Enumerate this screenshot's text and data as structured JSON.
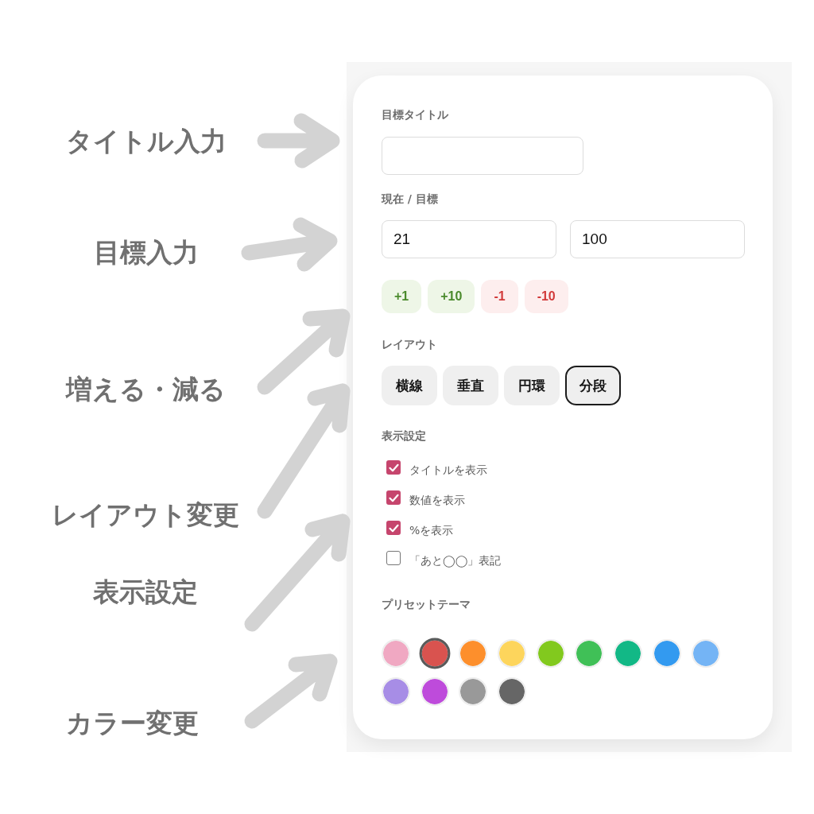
{
  "callouts": [
    {
      "label": "タイトル入力"
    },
    {
      "label": "目標入力"
    },
    {
      "label": "増える・減る"
    },
    {
      "label": "レイアウト変更"
    },
    {
      "label": "表示設定"
    },
    {
      "label": "カラー変更"
    }
  ],
  "panel": {
    "title_field": {
      "label": "目標タイトル"
    },
    "progress_fields": {
      "label": "現在 / 目標",
      "current": "21",
      "target": "100"
    },
    "step_buttons": [
      {
        "label": "+1",
        "kind": "increase"
      },
      {
        "label": "+10",
        "kind": "increase"
      },
      {
        "label": "-1",
        "kind": "decrease"
      },
      {
        "label": "-10",
        "kind": "decrease"
      }
    ],
    "layout": {
      "label": "レイアウト",
      "options": [
        {
          "label": "横線",
          "selected": false
        },
        {
          "label": "垂直",
          "selected": false
        },
        {
          "label": "円環",
          "selected": false
        },
        {
          "label": "分段",
          "selected": true
        }
      ]
    },
    "display_settings": {
      "label": "表示設定",
      "options": [
        {
          "label": "タイトルを表示",
          "checked": true
        },
        {
          "label": "数値を表示",
          "checked": true
        },
        {
          "label": "%を表示",
          "checked": true
        },
        {
          "label": "「あと◯◯」表記",
          "checked": false
        }
      ]
    },
    "preset_theme": {
      "label": "プリセットテーマ",
      "swatches": [
        {
          "color": "#f0a8c2",
          "selected": false
        },
        {
          "color": "#d9534f",
          "selected": true
        },
        {
          "color": "#fd8f2c",
          "selected": false
        },
        {
          "color": "#fdd55c",
          "selected": false
        },
        {
          "color": "#82c91e",
          "selected": false
        },
        {
          "color": "#40c057",
          "selected": false
        },
        {
          "color": "#12b886",
          "selected": false
        },
        {
          "color": "#339af0",
          "selected": false
        },
        {
          "color": "#74b4f5",
          "selected": false
        },
        {
          "color": "#a78de6",
          "selected": false
        },
        {
          "color": "#be4bdb",
          "selected": false
        },
        {
          "color": "#999999",
          "selected": false
        },
        {
          "color": "#666666",
          "selected": false
        }
      ]
    }
  }
}
